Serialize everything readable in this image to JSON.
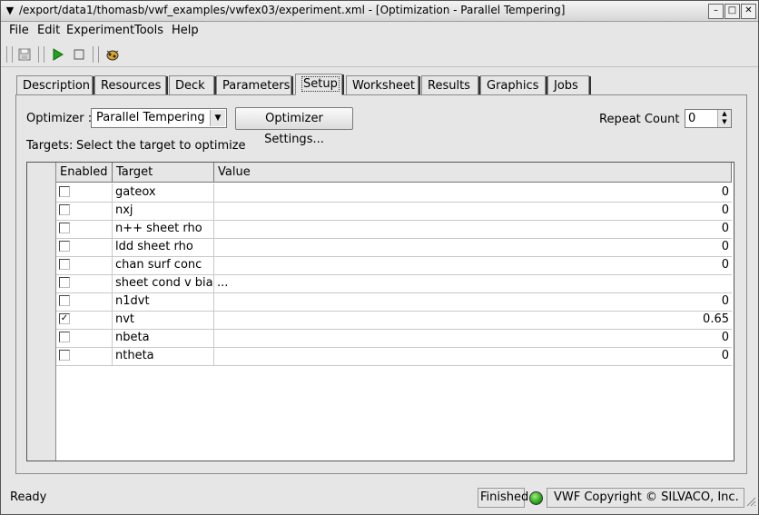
{
  "window": {
    "title": "/export/data1/thomasb/vwf_examples/vwfex03/experiment.xml - [Optimization - Parallel Tempering]"
  },
  "menubar": [
    "File",
    "Edit",
    "Experiment",
    "Tools",
    "Help"
  ],
  "tabs": [
    "Description",
    "Resources",
    "Deck",
    "Parameters",
    "Setup",
    "Worksheet",
    "Results",
    "Graphics",
    "Jobs"
  ],
  "active_tab": "Setup",
  "setup": {
    "optimizer_label": "Optimizer :",
    "optimizer_value": "Parallel Tempering",
    "optimizer_settings_button": "Optimizer Settings...",
    "repeat_count_label": "Repeat Count :",
    "repeat_count_value": "0",
    "targets_label": "Targets:",
    "targets_hint": "Select the target to optimize"
  },
  "table": {
    "columns": [
      "Enabled",
      "Target",
      "Value"
    ],
    "rows": [
      {
        "enabled": false,
        "target": "gateox",
        "value": "0"
      },
      {
        "enabled": false,
        "target": "nxj",
        "value": "0"
      },
      {
        "enabled": false,
        "target": "n++ sheet rho",
        "value": "0"
      },
      {
        "enabled": false,
        "target": "ldd sheet rho",
        "value": "0"
      },
      {
        "enabled": false,
        "target": "chan surf conc",
        "value": "0"
      },
      {
        "enabled": false,
        "target": "sheet cond v bias",
        "value": "..."
      },
      {
        "enabled": false,
        "target": "n1dvt",
        "value": "0"
      },
      {
        "enabled": true,
        "target": "nvt",
        "value": "0.65"
      },
      {
        "enabled": false,
        "target": "nbeta",
        "value": "0"
      },
      {
        "enabled": false,
        "target": "ntheta",
        "value": "0"
      }
    ]
  },
  "status": {
    "left": "Ready",
    "job_state": "Finished",
    "copyright": "VWF Copyright ©  SILVACO, Inc."
  },
  "colors": {
    "play": "#1fa01f",
    "led": "#2aa21a"
  }
}
